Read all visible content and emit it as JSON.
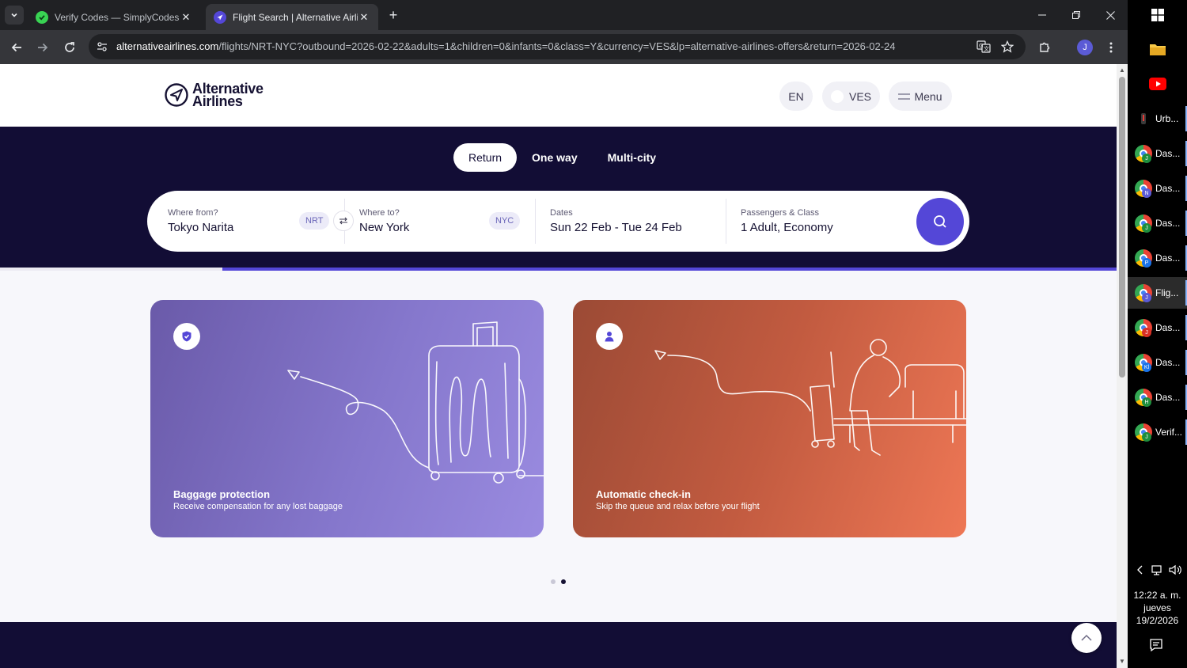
{
  "browser": {
    "tabs": [
      {
        "title": "Verify Codes — SimplyCodes",
        "active": false
      },
      {
        "title": "Flight Search | Alternative Airlin",
        "active": true
      }
    ],
    "url_host": "alternativeairlines.com",
    "url_rest": "/flights/NRT-NYC?outbound=2026-02-22&adults=1&children=0&infants=0&class=Y&currency=VES&lp=alternative-airlines-offers&return=2026-02-24",
    "profile_initial": "J"
  },
  "header": {
    "logo_line1": "Alternative",
    "logo_line2": "Airlines",
    "language": "EN",
    "currency": "VES",
    "menu": "Menu"
  },
  "search": {
    "trip_types": [
      "Return",
      "One way",
      "Multi-city"
    ],
    "selected_trip": "Return",
    "from_label": "Where from?",
    "from_value": "Tokyo Narita",
    "from_code": "NRT",
    "to_label": "Where to?",
    "to_value": "New York",
    "to_code": "NYC",
    "dates_label": "Dates",
    "dates_value": "Sun 22 Feb - Tue 24 Feb",
    "pax_label": "Passengers & Class",
    "pax_value": "1 Adult, Economy"
  },
  "progress": 0.8,
  "cards": [
    {
      "title": "Baggage protection",
      "subtitle": "Receive compensation for any lost baggage",
      "icon": "shield-check-icon",
      "color": "#8577cc"
    },
    {
      "title": "Automatic check-in",
      "subtitle": "Skip the queue and relax before your flight",
      "icon": "person-icon",
      "color": "#c25b40"
    }
  ],
  "carousel": {
    "count": 2,
    "active": 2
  },
  "taskbar": {
    "items": [
      {
        "label": "Urb...",
        "profile": ""
      },
      {
        "label": "Das...",
        "profile": "J",
        "profile_color": "#1e8e3e"
      },
      {
        "label": "Das...",
        "profile": "N",
        "profile_color": "#5b5bd6"
      },
      {
        "label": "Das...",
        "profile": "J",
        "profile_color": "#1e8e3e"
      },
      {
        "label": "Das...",
        "profile": "P",
        "profile_color": "#1a73e8"
      },
      {
        "label": "Flig...",
        "profile": "J",
        "profile_color": "#5b5bd6",
        "active": true
      },
      {
        "label": "Das...",
        "profile": "J",
        "profile_color": "#d93025"
      },
      {
        "label": "Das...",
        "profile": "Kl",
        "profile_color": "#1a73e8"
      },
      {
        "label": "Das...",
        "profile": "H",
        "profile_color": "#1e8e3e"
      },
      {
        "label": "Verif...",
        "profile": "J",
        "profile_color": "#1e8e3e"
      }
    ],
    "time": "12:22 a. m.",
    "day": "jueves",
    "date": "19/2/2026"
  },
  "colors": {
    "brand": "#5447d7",
    "hero_bg": "#120d35"
  }
}
